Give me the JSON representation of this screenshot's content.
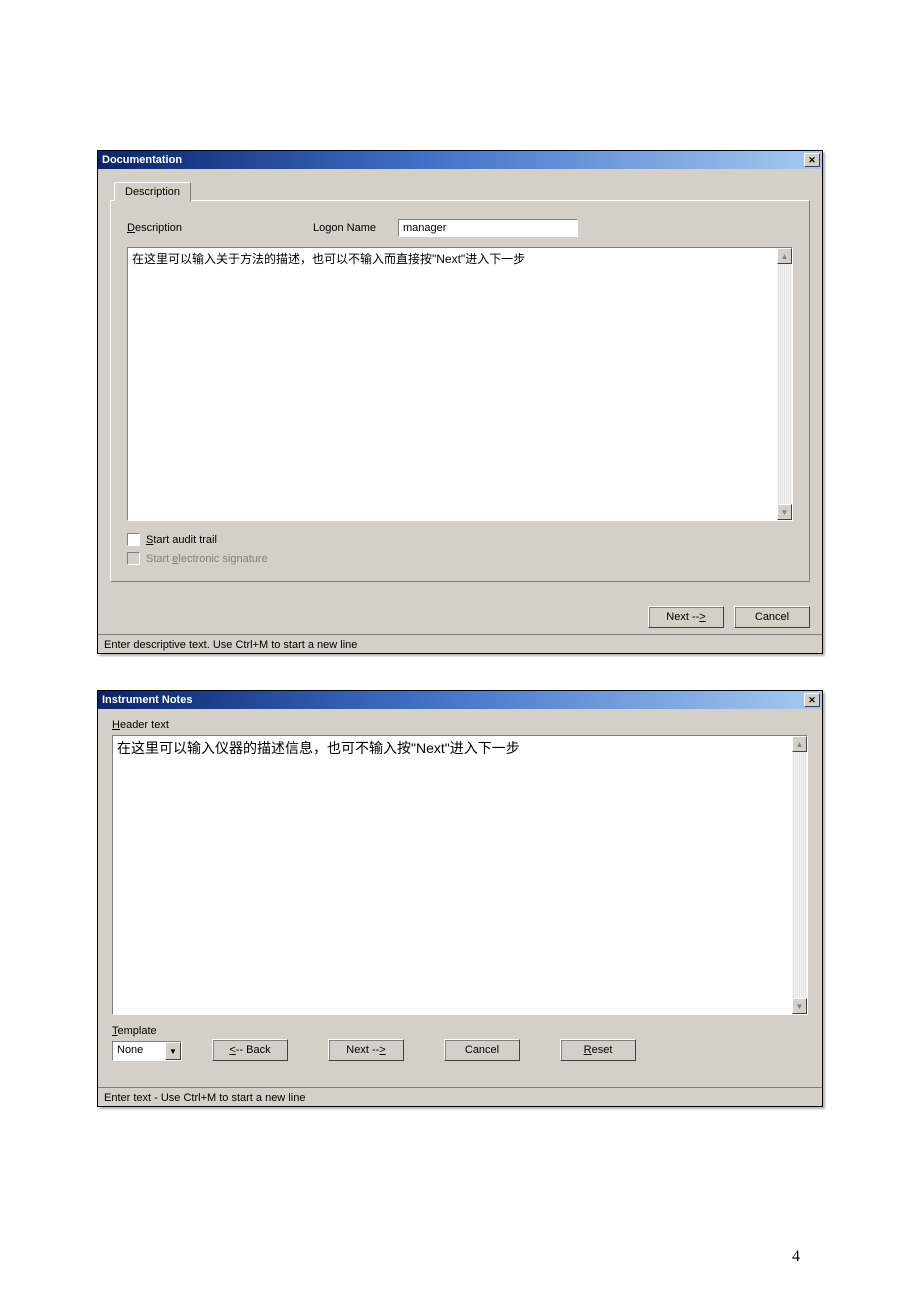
{
  "dialog1": {
    "title": "Documentation",
    "close_glyph": "✕",
    "tab_label": "Description",
    "desc_label_pre": "D",
    "desc_label_post": "escription",
    "logon_label": "Logon Name",
    "logon_value": "manager",
    "textarea_value": "在这里可以输入关于方法的描述，也可以不输入而直接按\"Next\"进入下一步",
    "scroll_up": "▲",
    "scroll_down": "▼",
    "check_audit_pre": "S",
    "check_audit_post": "tart audit trail",
    "check_sig_pre_text": "Start ",
    "check_sig_u": "e",
    "check_sig_post": "lectronic signature",
    "next_label": "Next -->",
    "next_u": ">",
    "cancel_label": "Cancel",
    "status": "Enter descriptive text. Use Ctrl+M to start a new line"
  },
  "dialog2": {
    "title": "Instrument Notes",
    "close_glyph": "✕",
    "header_u": "H",
    "header_post": "eader text",
    "textarea_value": "在这里可以输入仪器的描述信息，也可不输入按\"Next\"进入下一步",
    "scroll_up": "▲",
    "scroll_down": "▼",
    "template_u": "T",
    "template_post": "emplate",
    "template_value": "None",
    "combo_arrow": "▼",
    "back_u": "<",
    "back_label": "<-- Back",
    "next_label": "Next -->",
    "next_u": ">",
    "cancel_label": "Cancel",
    "reset_u": "R",
    "reset_post": "eset",
    "status": "Enter text - Use Ctrl+M to start a new line"
  },
  "page_number": "4"
}
